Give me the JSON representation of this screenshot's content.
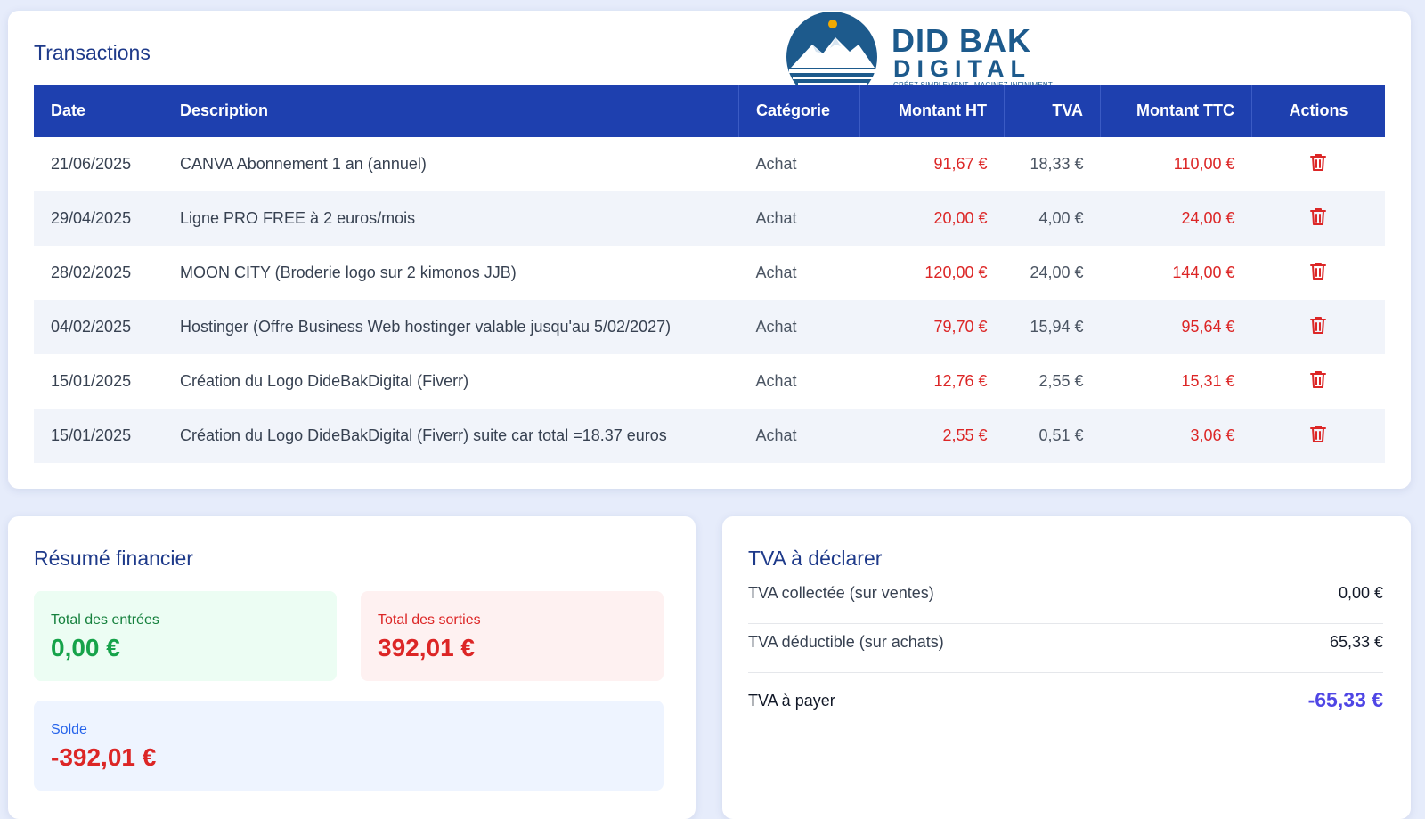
{
  "logo": {
    "line1": "DID BAK",
    "line2": "DIGITAL",
    "tagline": "CRÉEZ SIMPLEMENT, IMAGINEZ INFINIMENT."
  },
  "transactions": {
    "title": "Transactions",
    "columns": [
      "Date",
      "Description",
      "Catégorie",
      "Montant HT",
      "TVA",
      "Montant TTC",
      "Actions"
    ],
    "rows": [
      {
        "date": "21/06/2025",
        "description": "CANVA Abonnement 1 an (annuel)",
        "category": "Achat",
        "ht": "91,67 €",
        "tva": "18,33 €",
        "ttc": "110,00 €",
        "action_icon": "trash-icon"
      },
      {
        "date": "29/04/2025",
        "description": "Ligne PRO FREE à 2 euros/mois",
        "category": "Achat",
        "ht": "20,00 €",
        "tva": "4,00 €",
        "ttc": "24,00 €",
        "action_icon": "trash-icon"
      },
      {
        "date": "28/02/2025",
        "description": "MOON CITY (Broderie logo sur 2 kimonos JJB)",
        "category": "Achat",
        "ht": "120,00 €",
        "tva": "24,00 €",
        "ttc": "144,00 €",
        "action_icon": "trash-icon"
      },
      {
        "date": "04/02/2025",
        "description": "Hostinger (Offre Business Web hostinger valable jusqu'au 5/02/2027)",
        "category": "Achat",
        "ht": "79,70 €",
        "tva": "15,94 €",
        "ttc": "95,64 €",
        "action_icon": "trash-icon"
      },
      {
        "date": "15/01/2025",
        "description": "Création du Logo DideBakDigital (Fiverr)",
        "category": "Achat",
        "ht": "12,76 €",
        "tva": "2,55 €",
        "ttc": "15,31 €",
        "action_icon": "trash-icon"
      },
      {
        "date": "15/01/2025",
        "description": "Création du Logo DideBakDigital (Fiverr) suite car total =18.37 euros",
        "category": "Achat",
        "ht": "2,55 €",
        "tva": "0,51 €",
        "ttc": "3,06 €",
        "action_icon": "trash-icon"
      }
    ]
  },
  "summary": {
    "title": "Résumé financier",
    "income_label": "Total des entrées",
    "income_value": "0,00 €",
    "expense_label": "Total des sorties",
    "expense_value": "392,01 €",
    "balance_label": "Solde",
    "balance_value": "-392,01 €"
  },
  "vat": {
    "title": "TVA à déclarer",
    "collected_label": "TVA collectée (sur ventes)",
    "collected_value": "0,00 €",
    "deductible_label": "TVA déductible (sur achats)",
    "deductible_value": "65,33 €",
    "payable_label": "TVA à payer",
    "payable_value": "-65,33 €"
  },
  "colors": {
    "header_blue": "#1e40af",
    "amount_red": "#dc2626",
    "income_green": "#16a34a",
    "payable_indigo": "#4f46e5",
    "page_bg": "#e6ecfb"
  }
}
